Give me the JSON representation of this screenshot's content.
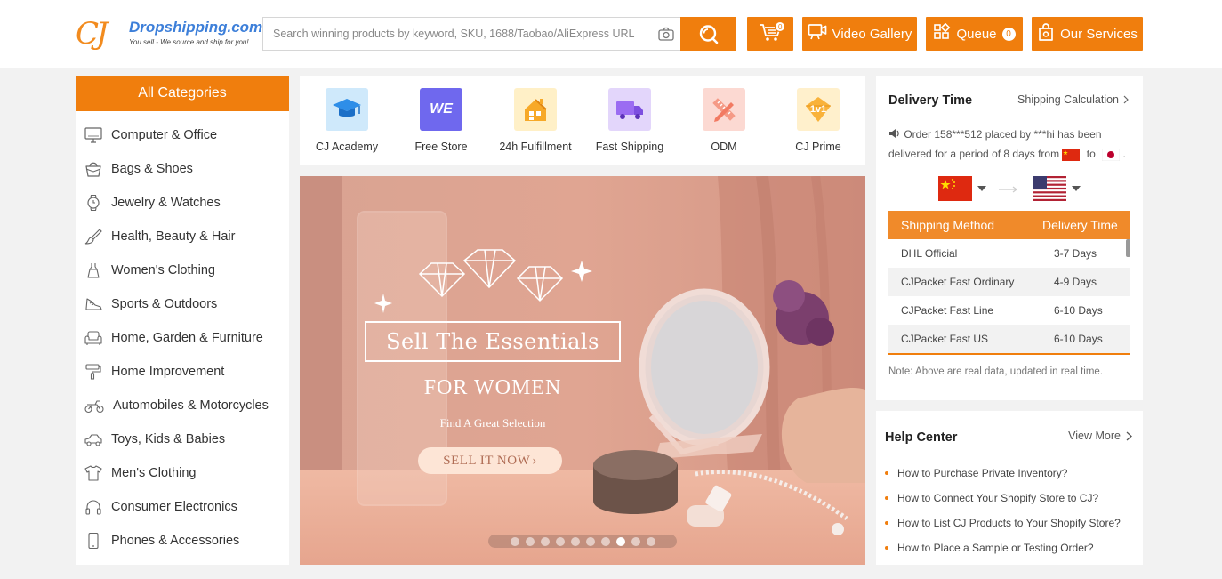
{
  "header": {
    "logo_mark": "CJ",
    "logo_name": "Dropshipping.com",
    "logo_slogan": "You sell - We source and ship for you!",
    "search_placeholder": "Search winning products by keyword, SKU, 1688/Taobao/AliExpress URL",
    "cart_count": "0",
    "video_gallery_label": "Video Gallery",
    "queue_label": "Queue",
    "queue_count": "0",
    "our_services_label": "Our Services",
    "accent_color": "#f07e0d"
  },
  "categories": {
    "title": "All Categories",
    "items": [
      {
        "label": "Computer & Office",
        "icon": "computer-icon"
      },
      {
        "label": "Bags & Shoes",
        "icon": "bag-icon"
      },
      {
        "label": "Jewelry & Watches",
        "icon": "watch-icon"
      },
      {
        "label": "Health, Beauty & Hair",
        "icon": "brush-icon"
      },
      {
        "label": "Women's Clothing",
        "icon": "dress-icon"
      },
      {
        "label": "Sports & Outdoors",
        "icon": "shoe-icon"
      },
      {
        "label": "Home, Garden & Furniture",
        "icon": "sofa-icon"
      },
      {
        "label": "Home Improvement",
        "icon": "paint-roller-icon"
      },
      {
        "label": "Automobiles & Motorcycles",
        "icon": "motorcycle-icon"
      },
      {
        "label": "Toys, Kids & Babies",
        "icon": "toy-car-icon"
      },
      {
        "label": "Men's Clothing",
        "icon": "shirt-icon"
      },
      {
        "label": "Consumer Electronics",
        "icon": "headphones-icon"
      },
      {
        "label": "Phones & Accessories",
        "icon": "phone-icon"
      }
    ]
  },
  "features": [
    {
      "label": "CJ Academy",
      "icon": "graduation-cap-icon"
    },
    {
      "label": "Free Store",
      "icon": "we-store-icon",
      "icon_text": "WE"
    },
    {
      "label": "24h Fulfillment",
      "icon": "house-icon"
    },
    {
      "label": "Fast Shipping",
      "icon": "truck-icon"
    },
    {
      "label": "ODM",
      "icon": "ruler-pencil-icon"
    },
    {
      "label": "CJ Prime",
      "icon": "prime-badge-icon",
      "icon_text": "1v1"
    }
  ],
  "banner": {
    "title": "Sell The Essentials",
    "subtitle": "FOR WOMEN",
    "small_text": "Find A Great Selection",
    "cta": "SELL IT NOW",
    "slide_count": 10,
    "active_slide": 8
  },
  "delivery": {
    "title": "Delivery Time",
    "link": "Shipping Calculation",
    "message_prefix": "Order 158***512 placed by ***hi has been delivered for a period of 8 days from",
    "message_to": "to",
    "message_end": ".",
    "table_headers": [
      "Shipping Method",
      "Delivery Time"
    ],
    "rows": [
      {
        "method": "DHL Official",
        "time": "3-7 Days"
      },
      {
        "method": "CJPacket Fast Ordinary",
        "time": "4-9 Days"
      },
      {
        "method": "CJPacket Fast Line",
        "time": "6-10 Days"
      },
      {
        "method": "CJPacket Fast US",
        "time": "6-10 Days"
      }
    ],
    "note": "Note: Above are real data, updated in real time."
  },
  "help": {
    "title": "Help Center",
    "link": "View More",
    "items": [
      "How to Purchase Private Inventory?",
      "How to Connect Your Shopify Store to CJ?",
      "How to List CJ Products to Your Shopify Store?",
      "How to Place a Sample or Testing Order?"
    ]
  }
}
